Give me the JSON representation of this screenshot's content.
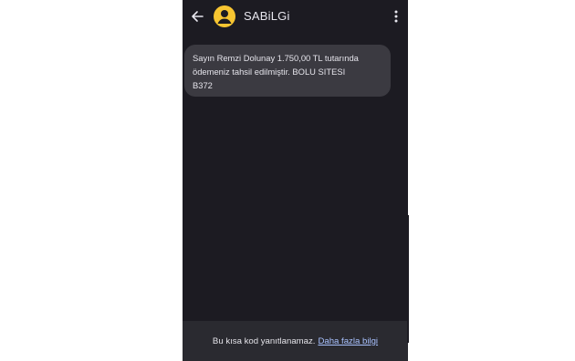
{
  "header": {
    "back_icon": "arrow-left-icon",
    "avatar_icon": "person-icon",
    "title": "SABiLGi",
    "more_icon": "more-vert-icon"
  },
  "messages": [
    {
      "lines": [
        "Sayın Remzi Dolunay 1.750,00 TL tutarında",
        "ödemeniz tahsil edilmiştir. BOLU SITESI",
        "B372"
      ]
    }
  ],
  "footer": {
    "notice": "Bu kısa kod yanıtlanamaz.",
    "link": "Daha fazla bilgi"
  },
  "colors": {
    "background": "#1c1b22",
    "bubble": "#3b3a41",
    "avatar": "#f7c531",
    "link": "#a9c2ff",
    "footer": "#2a2a30"
  }
}
